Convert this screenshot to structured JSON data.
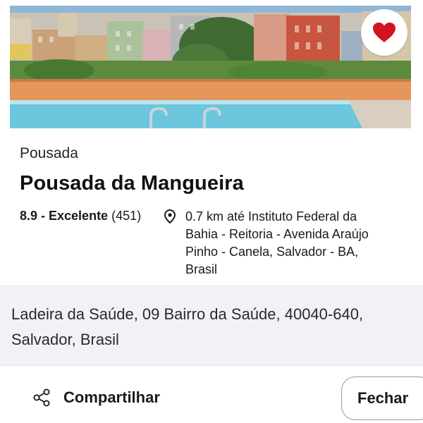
{
  "hotel": {
    "type": "Pousada",
    "name": "Pousada da Mangueira",
    "rating_score": "8.9 - Excelente",
    "rating_count": "(451)",
    "distance_line1": "0.7 km até Instituto Federal da",
    "distance_line2": "Bahia - Reitoria - Avenida Araújo",
    "distance_line3": "Pinho - Canela, Salvador - BA,",
    "distance_line4": "Brasil",
    "address_line1": "Ladeira da Saúde, 09 Bairro da Saúde, 40040-640,",
    "address_line2": "Salvador, Brasil"
  },
  "actions": {
    "share_label": "Compartilhar",
    "close_label": "Fechar"
  },
  "icons": {
    "favorite": "heart-icon",
    "location": "map-pin-icon",
    "share": "share-icon"
  },
  "colors": {
    "heart": "#d3131e",
    "address_background": "#f1f2f5"
  }
}
